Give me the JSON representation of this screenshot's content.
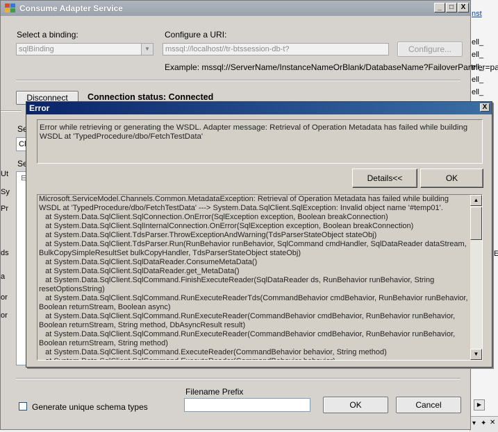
{
  "window": {
    "title": "Consume Adapter Service",
    "minimize_label": "_",
    "maximize_label": "□",
    "close_label": "X"
  },
  "binding": {
    "label": "Select a binding:",
    "value": "sqlBinding"
  },
  "uri": {
    "label": "Configure a URI:",
    "value": "mssql://localhost//tr-btssession-db-t?",
    "configure_button": "Configure...",
    "example": "Example: mssql://ServerName/InstanceNameOrBlank/DatabaseName?FailoverPartner=pa"
  },
  "connection": {
    "disconnect_button": "Disconnect",
    "status": "Connection status: Connected"
  },
  "partial_labels": {
    "se1": "Se",
    "cli": "Cli",
    "se2": "Se",
    "left_fragments": [
      "Ut",
      "Sy",
      "Pr",
      "ds",
      "a",
      "or",
      "or"
    ]
  },
  "bottom": {
    "generate_unique_label": "Generate unique schema types",
    "filename_prefix_label": "Filename Prefix",
    "filename_prefix_value": "",
    "ok_button": "OK",
    "cancel_button": "Cancel"
  },
  "background_app": {
    "link": "nst",
    "items": [
      "ell_",
      "ell_",
      "ell_",
      "ell_",
      "ell_"
    ],
    "right_letter": "E"
  },
  "error_dialog": {
    "title": "Error",
    "close_label": "X",
    "message": "Error while retrieving or generating the WSDL. Adapter message: Retrieval of Operation Metadata has failed while building WSDL at 'TypedProcedure/dbo/FetchTestData'",
    "details_button": "Details<<",
    "ok_button": "OK",
    "details": "Microsoft.ServiceModel.Channels.Common.MetadataException: Retrieval of Operation Metadata has failed while building WSDL at 'TypedProcedure/dbo/FetchTestData' ---> System.Data.SqlClient.SqlException: Invalid object name '#temp01'.\n   at System.Data.SqlClient.SqlConnection.OnError(SqlException exception, Boolean breakConnection)\n   at System.Data.SqlClient.SqlInternalConnection.OnError(SqlException exception, Boolean breakConnection)\n   at System.Data.SqlClient.TdsParser.ThrowExceptionAndWarning(TdsParserStateObject stateObj)\n   at System.Data.SqlClient.TdsParser.Run(RunBehavior runBehavior, SqlCommand cmdHandler, SqlDataReader dataStream, BulkCopySimpleResultSet bulkCopyHandler, TdsParserStateObject stateObj)\n   at System.Data.SqlClient.SqlDataReader.ConsumeMetaData()\n   at System.Data.SqlClient.SqlDataReader.get_MetaData()\n   at System.Data.SqlClient.SqlCommand.FinishExecuteReader(SqlDataReader ds, RunBehavior runBehavior, String resetOptionsString)\n   at System.Data.SqlClient.SqlCommand.RunExecuteReaderTds(CommandBehavior cmdBehavior, RunBehavior runBehavior, Boolean returnStream, Boolean async)\n   at System.Data.SqlClient.SqlCommand.RunExecuteReader(CommandBehavior cmdBehavior, RunBehavior runBehavior, Boolean returnStream, String method, DbAsyncResult result)\n   at System.Data.SqlClient.SqlCommand.RunExecuteReader(CommandBehavior cmdBehavior, RunBehavior runBehavior, Boolean returnStream, String method)\n   at System.Data.SqlClient.SqlCommand.ExecuteReader(CommandBehavior behavior, String method)\n   at System.Data.SqlClient.SqlCommand.ExecuteReader(CommandBehavior behavior)"
  },
  "colors": {
    "dialog_title_start": "#0a246a",
    "dialog_title_end": "#3a6ea5",
    "window_title": "#9aa3ad",
    "link": "#0645ad"
  }
}
